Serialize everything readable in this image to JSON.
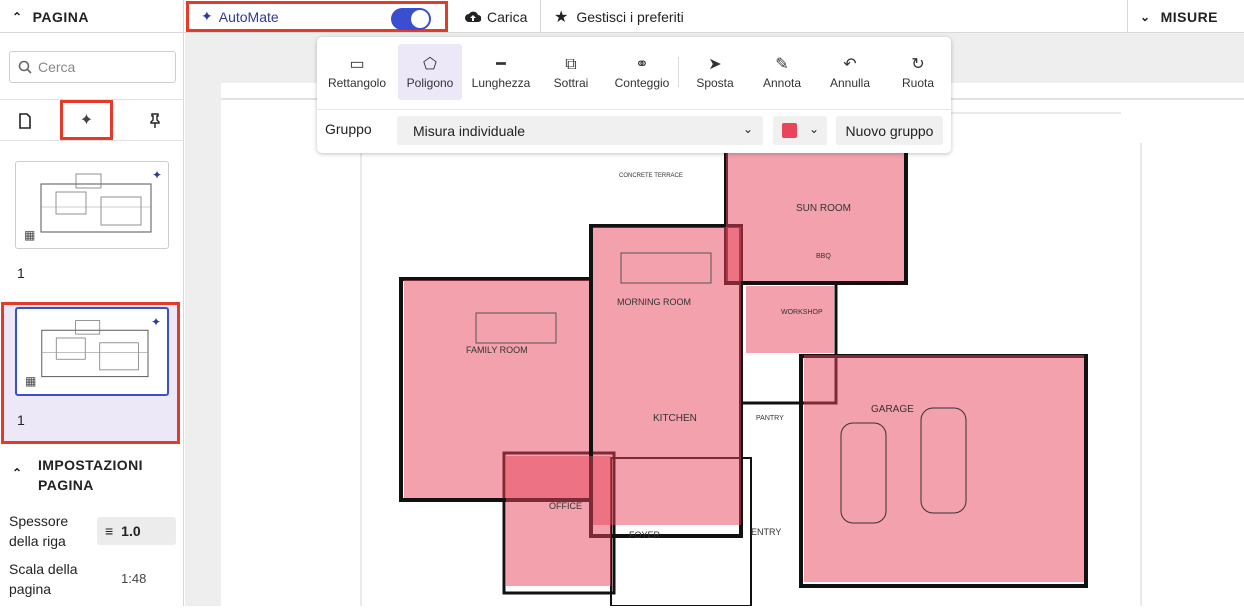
{
  "topbar": {
    "pagina": "PAGINA",
    "automate": "AutoMate",
    "carica": "Carica",
    "preferiti": "Gestisci i preferiti",
    "misure": "MISURE"
  },
  "sidebar": {
    "search_placeholder": "Cerca",
    "pages": [
      {
        "number": "1"
      },
      {
        "number": "1"
      }
    ],
    "settings_title_1": "IMPOSTAZIONI",
    "settings_title_2": "PAGINA",
    "spessore_1": "Spessore",
    "spessore_2": "della riga",
    "spessore_value": "1.0",
    "scala_1": "Scala della",
    "scala_2": "pagina",
    "scala_value": "1:48"
  },
  "toolbar": {
    "tools": [
      "Rettangolo",
      "Poligono",
      "Lunghezza",
      "Sottrai",
      "Conteggio",
      "Sposta",
      "Annota",
      "Annulla",
      "Ruota"
    ],
    "active_tool": "Poligono",
    "gruppo_label": "Gruppo",
    "gruppo_value": "Misura individuale",
    "color": "#e8445a",
    "nuovo_gruppo": "Nuovo gruppo"
  },
  "plan": {
    "rooms": [
      "SUN ROOM",
      "FAMILY ROOM",
      "MORNING ROOM",
      "KITCHEN",
      "WORKSHOP",
      "PANTRY",
      "GARAGE",
      "OFFICE",
      "FOYER",
      "ENTRY",
      "BBQ"
    ],
    "notes": [
      "CONCRETE TERRACE"
    ],
    "highlight_color": "#e8445a"
  }
}
